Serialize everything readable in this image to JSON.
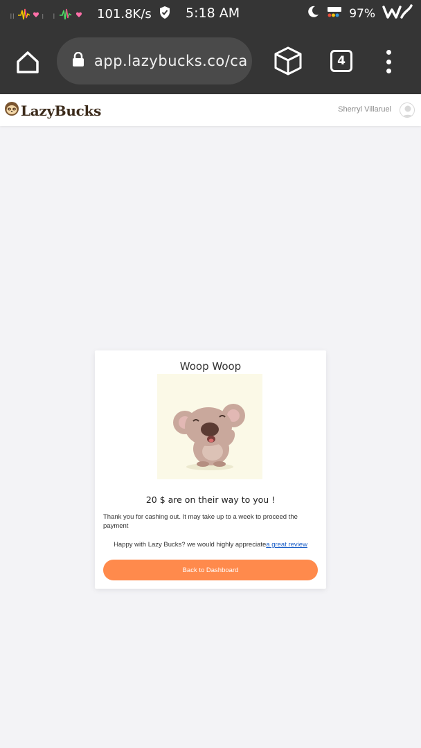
{
  "status_bar": {
    "net_speed": "101.8K/s",
    "time": "5:18 AM",
    "battery": "97%"
  },
  "browser": {
    "url": "app.lazybucks.co/ca",
    "tab_count": "4"
  },
  "site": {
    "logo_text": "LazyBucks",
    "user_name": "Sherryl Villaruel"
  },
  "card": {
    "title": "Woop Woop",
    "amount_message": "20 $ are on their way to you !",
    "thanks_message": "Thank you for cashing out. It may take up to a week to proceed the payment",
    "review_prefix": "Happy with Lazy Bucks? we would highly appreciate",
    "review_link": "a great review",
    "button_label": "Back to Dashboard"
  },
  "colors": {
    "bar_background": "#353535",
    "button": "#ff8a4c",
    "link": "#1a5ec7",
    "page_background": "#f3f3f6"
  }
}
